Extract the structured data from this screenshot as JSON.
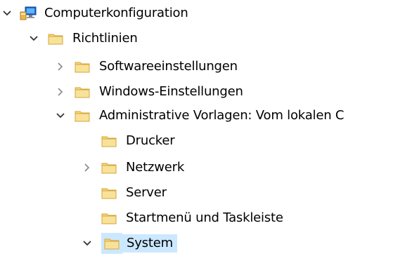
{
  "tree": {
    "root": {
      "label": "Computerkonfiguration",
      "icon": "computer-icon",
      "expanded": true
    },
    "richtlinien": {
      "label": "Richtlinien",
      "icon": "folder-icon",
      "expanded": true
    },
    "software": {
      "label": "Softwareeinstellungen",
      "icon": "folder-icon",
      "expanded": false
    },
    "windows": {
      "label": "Windows-Einstellungen",
      "icon": "folder-icon",
      "expanded": false
    },
    "admin": {
      "label": "Administrative Vorlagen: Vom lokalen C",
      "icon": "folder-icon",
      "expanded": true
    },
    "drucker": {
      "label": "Drucker",
      "icon": "folder-icon"
    },
    "netzwerk": {
      "label": "Netzwerk",
      "icon": "folder-icon",
      "expanded": false
    },
    "server": {
      "label": "Server",
      "icon": "folder-icon"
    },
    "startmenu": {
      "label": "Startmenü und Taskleiste",
      "icon": "folder-icon"
    },
    "system": {
      "label": "System",
      "icon": "folder-icon",
      "expanded": true,
      "selected": true
    }
  },
  "colors": {
    "selection": "#cce8ff",
    "chevron": "#333333",
    "folder_body": "#f5d77a",
    "folder_tab": "#e8b84a"
  }
}
